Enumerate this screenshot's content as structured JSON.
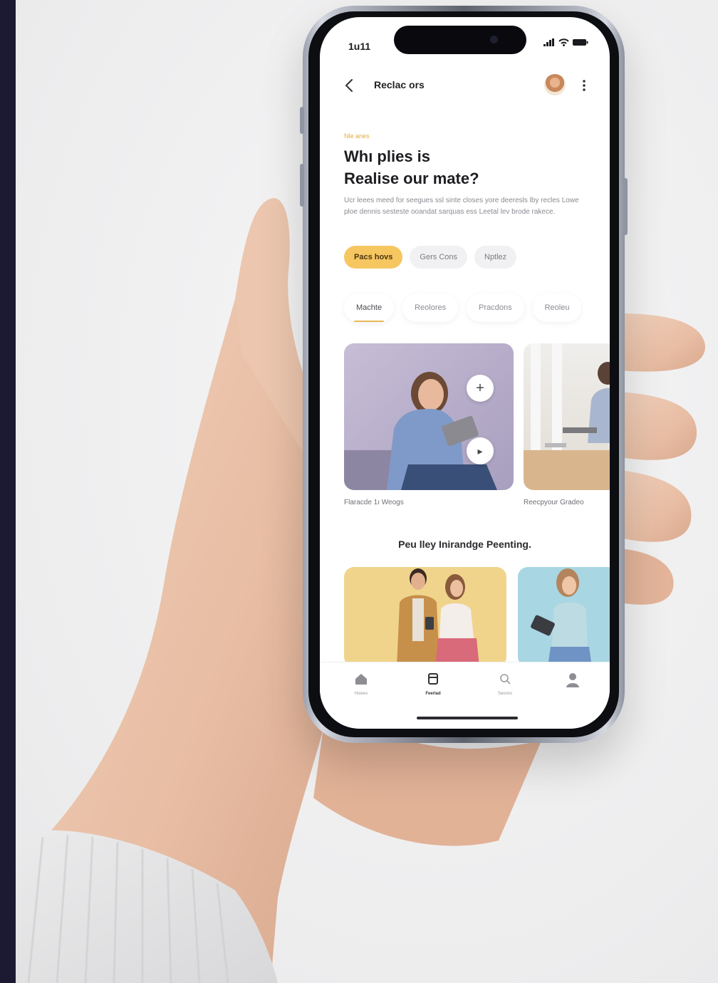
{
  "status_bar": {
    "time": "1u11"
  },
  "topbar": {
    "title": "Reclac ors"
  },
  "hero": {
    "eyebrow": "Nle anes",
    "headline_line1": "Whı plies is",
    "headline_line2": "Realise our mate?",
    "body": "Ucr leees meed for seegues ssl sinte closes yore deeresls lby recles Lowe ploe dennis sesteste ooandat sarquas ess Leetal lev brode rakece."
  },
  "chips": [
    {
      "label": "Pacs hovs",
      "active": true
    },
    {
      "label": "Gers Cons",
      "active": false
    },
    {
      "label": "Nptlez",
      "active": false
    }
  ],
  "tabs": [
    {
      "label": "Machte",
      "active": true
    },
    {
      "label": "Reolores",
      "active": false
    },
    {
      "label": "Pracdons",
      "active": false
    },
    {
      "label": "Reoleu",
      "active": false
    }
  ],
  "cards": [
    {
      "caption": "Flaracde 1ı Weogs"
    },
    {
      "caption": "Reecpyour Gradeo"
    }
  ],
  "section": {
    "title": "Peu lley Inirandge Peenting."
  },
  "bottom_nav": [
    {
      "label": "Hoiees",
      "icon": "home-icon",
      "active": false
    },
    {
      "label": "Feerlad",
      "icon": "bookmark-icon",
      "active": true
    },
    {
      "label": "Seoons",
      "icon": "search-icon",
      "active": false
    },
    {
      "label": "",
      "icon": "profile-icon",
      "active": false
    }
  ],
  "colors": {
    "accent": "#f6c661",
    "tab_underline": "#e9b957",
    "background_strip": "#1c1a33"
  }
}
